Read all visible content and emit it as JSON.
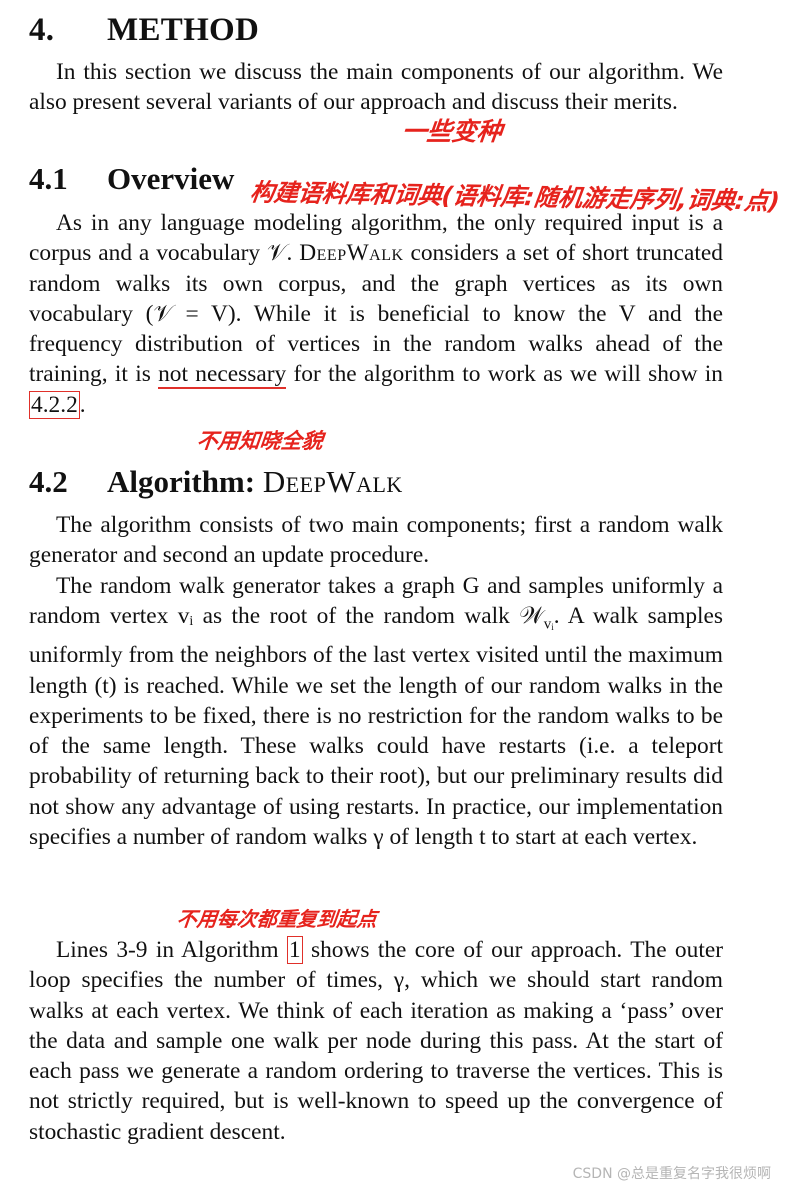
{
  "section": {
    "number": "4.",
    "title": "METHOD",
    "intro": "In this section we discuss the main components of our algorithm. We also present several variants of our approach and discuss their merits."
  },
  "overview": {
    "number": "4.1",
    "title": "Overview",
    "text_a": "As in any language modeling algorithm, the only required input is a corpus and a vocabulary 𝒱. ",
    "name": "DeepWalk",
    "text_b": " considers a set of short truncated random walks its own corpus, and the graph vertices as its own vocabulary (𝒱 = V). While it is beneficial to know the V and the frequency distribution of vertices in the random walks ahead of the training, it is ",
    "underlined": "not necessary",
    "text_c": " for the algorithm to work as we will show in ",
    "ref": "4.2.2",
    "text_d": "."
  },
  "algorithm": {
    "number": "4.2",
    "title_bold": "Algorithm:",
    "title_sc": "DeepWalk",
    "p1": "The algorithm consists of two main components; first a random walk generator and second an update procedure.",
    "p2_a": "The random walk generator takes a graph G and samples uniformly a random vertex vᵢ as the root of the random walk 𝒲",
    "p2_sub": "vᵢ",
    "p2_b": ". A walk samples uniformly from the neighbors of the last vertex visited until the maximum length (t) is reached. While we set the length of our random walks in the experiments to be fixed, there is no restriction for the random walks to be of the same length. These walks could have restarts (i.e. a teleport probability of returning back to their root), but our preliminary results did not show any advantage of using restarts. In practice, our implementation specifies a number of random walks γ of length t to start at each vertex.",
    "p3_a": "Lines 3-9 in Algorithm ",
    "p3_ref": "1",
    "p3_b": " shows the core of our approach. The outer loop specifies the number of times, γ, which we should start random walks at each vertex. We think of each iteration as making a ‘pass’ over the data and sample one walk per node during this pass. At the start of each pass we generate a random ordering to traverse the vertices. This is not strictly required, but is well-known to speed up the convergence of stochastic gradient descent."
  },
  "annotations": {
    "variants_note": "一些变种",
    "corpus_note": "构建语料库和词典(语料库:随机游走序列,词典:点)",
    "not_needed_note": "不用知晓全貌",
    "restart_note": "不用每次都重复到起点"
  },
  "watermark": "CSDN @总是重复名字我很烦啊",
  "colors": {
    "annotation": "#e6231d",
    "text": "#111111",
    "watermark": "#b5b5b5"
  }
}
